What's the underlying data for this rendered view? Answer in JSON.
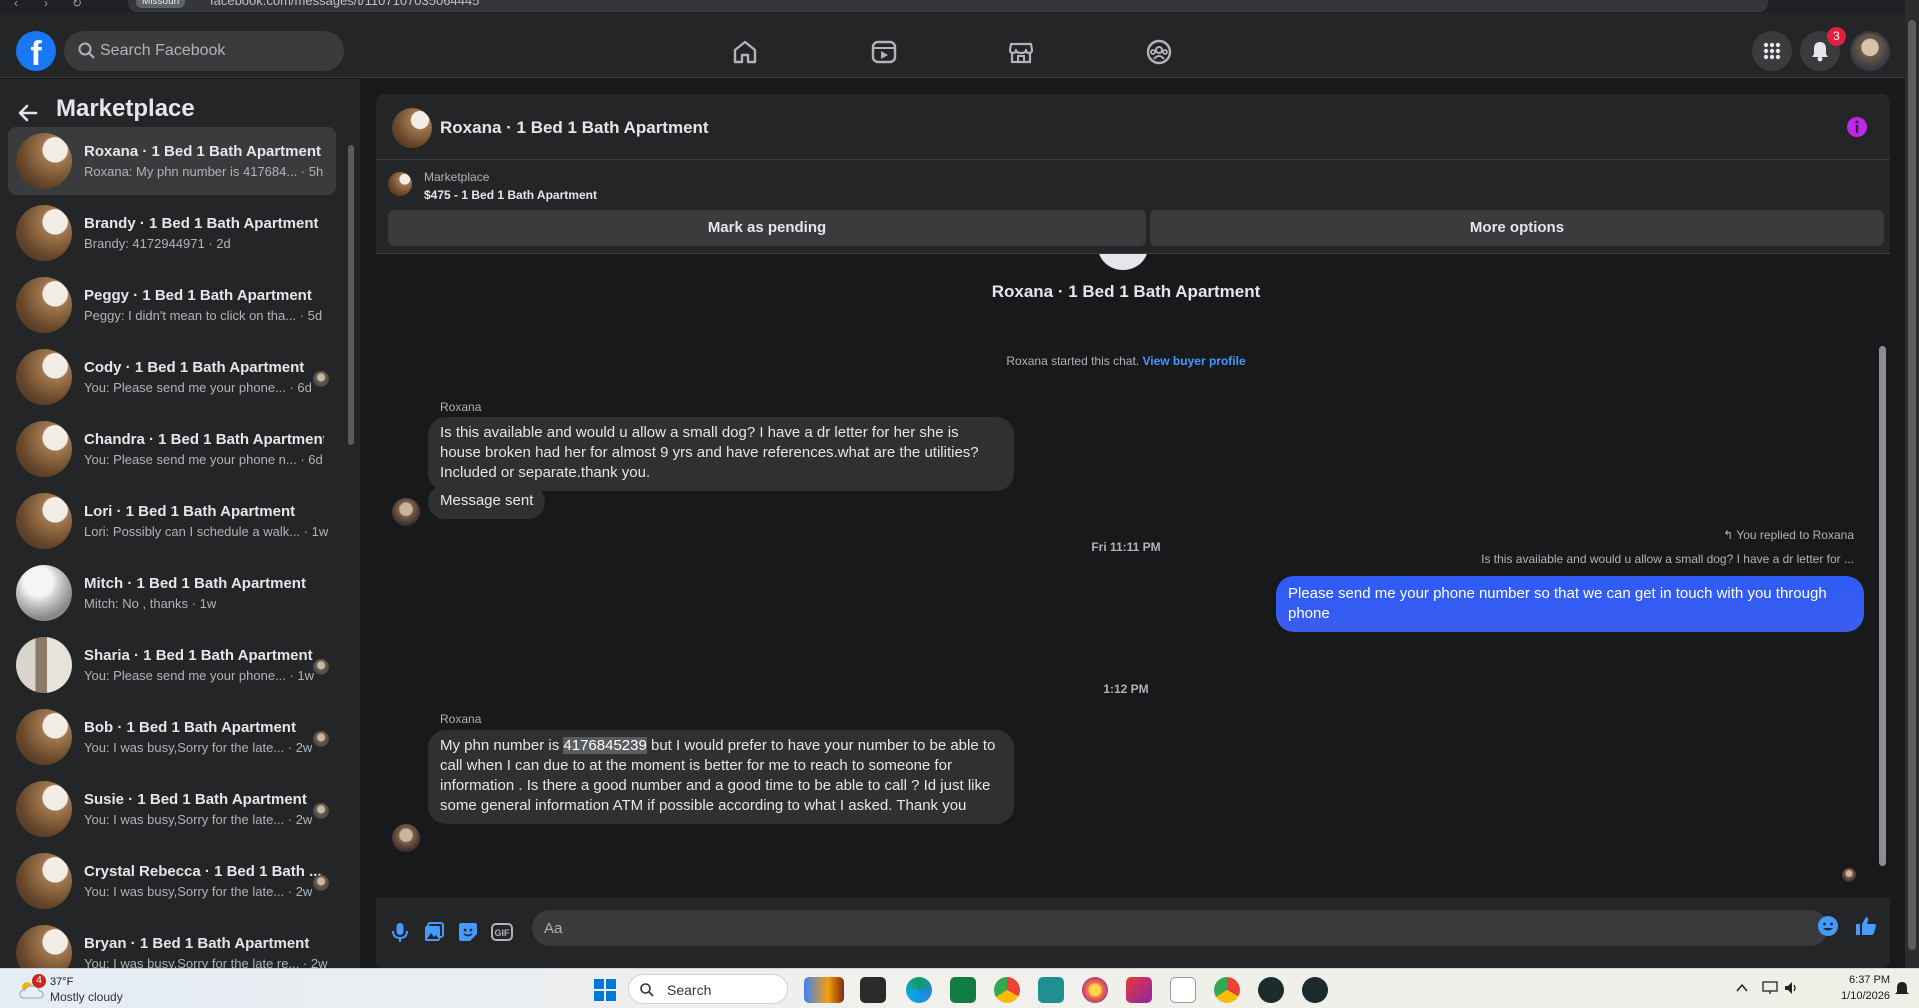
{
  "browser": {
    "profile_chip": "Missouri",
    "url": "facebook.com/messages/t/1107107035064445"
  },
  "topbar": {
    "logo": "f",
    "search_placeholder": "Search Facebook",
    "nav_icons": [
      "home-icon",
      "video-icon",
      "marketplace-icon",
      "groups-icon"
    ],
    "notifications_count": "3",
    "brand_color": "#1877f2"
  },
  "sidebar": {
    "title": "Marketplace",
    "conversations": [
      {
        "name": "Roxana · 1 Bed 1 Bath Apartment",
        "preview": "Roxana: My phn number is 417684... · 5h",
        "active": true
      },
      {
        "name": "Brandy · 1 Bed 1 Bath Apartment",
        "preview": "Brandy: 4172944971 · 2d"
      },
      {
        "name": "Peggy · 1 Bed 1 Bath Apartment",
        "preview": "Peggy: I didn't mean to click on tha... · 5d"
      },
      {
        "name": "Cody · 1 Bed 1 Bath Apartment",
        "preview": "You: Please send me your phone... · 6d"
      },
      {
        "name": "Chandra · 1 Bed 1 Bath Apartment",
        "preview": "You: Please send me your phone n... · 6d"
      },
      {
        "name": "Lori · 1 Bed 1 Bath Apartment",
        "preview": "Lori: Possibly can I schedule a walk... · 1w"
      },
      {
        "name": "Mitch · 1 Bed 1 Bath Apartment",
        "preview": "Mitch: No , thanks · 1w"
      },
      {
        "name": "Sharia · 1 Bed 1 Bath Apartment",
        "preview": "You: Please send me your phone... · 1w"
      },
      {
        "name": "Bob · 1 Bed 1 Bath Apartment",
        "preview": "You: I was busy,Sorry for the late... · 2w"
      },
      {
        "name": "Susie · 1 Bed 1 Bath Apartment",
        "preview": "You: I was busy,Sorry for the late... · 2w"
      },
      {
        "name": "Crystal Rebecca · 1 Bed 1 Bath ...",
        "preview": "You: I was busy,Sorry for the late... · 2w"
      },
      {
        "name": "Bryan · 1 Bed 1 Bath Apartment",
        "preview": "You: I was busy,Sorry for the late re... · 2w"
      }
    ]
  },
  "chat": {
    "title": "Roxana · 1 Bed 1 Bath Apartment",
    "listing_category": "Marketplace",
    "listing_title": "$475 - 1 Bed 1 Bath Apartment",
    "mark_pending_label": "Mark as pending",
    "more_options_label": "More options",
    "thread_title": "Roxana · 1 Bed 1 Bath Apartment",
    "started_text": "Roxana started this chat.",
    "view_profile_link": "View buyer profile",
    "messages": {
      "sender1": "Roxana",
      "msg1": "Is this available and would u allow a small dog? I have a dr letter for her she is house broken had her for almost 9 yrs and have references.what are the utilities? Included or separate.thank you.",
      "msg2": "Message sent",
      "time1": "Fri 11:11 PM",
      "reply_note": "You replied to Roxana",
      "quoted": "Is this available and would u allow a small dog? I have a dr letter for ...",
      "out1": "Please send me your phone  number so that we can get in touch with you through phone",
      "time2": "1:12 PM",
      "sender2": "Roxana",
      "msg3_pre": "My phn number is ",
      "msg3_number": "4176845239",
      "msg3_post": " but I would prefer to have your number to be able to call when I can due to at the moment is better for me to reach to someone for information . Is there a good number and a good time to be able to call ? Id just like some general information ATM if possible according to what I asked. Thank you"
    },
    "composer_placeholder": "Aa",
    "accent_color": "#0a5cff"
  },
  "taskbar": {
    "weather_badge": "4",
    "temperature": "37°F",
    "condition": "Mostly cloudy",
    "search_label": "Search",
    "time": "6:37 PM",
    "date": "1/10/2026"
  }
}
